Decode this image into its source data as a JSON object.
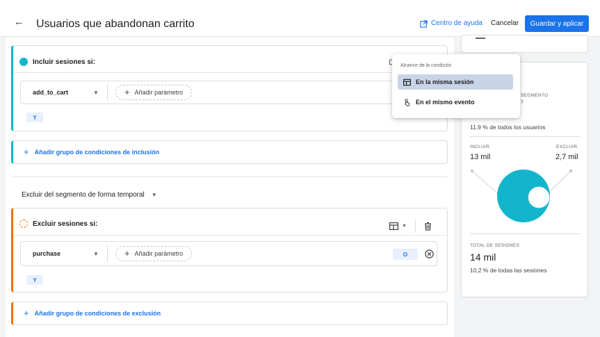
{
  "header": {
    "back_icon": "arrow-left-icon",
    "title": "Usuarios que abandonan carrito",
    "help_label": "Centro de ayuda",
    "help_icon": "external-link-icon",
    "cancel_label": "Cancelar",
    "save_label": "Guardar y aplicar",
    "accent_color": "#1a73e8"
  },
  "include_group": {
    "title": "Incluir sesiones si:",
    "color": "#12b5cb",
    "condition": {
      "event": "add_to_cart",
      "add_param_label": "Añadir parámetro"
    },
    "and_label": "Y"
  },
  "add_include_group_label": "Añadir grupo de condiciones de inclusión",
  "temporal_exclude_label": "Excluir del segmento de forma temporal",
  "exclude_group": {
    "title": "Excluir sesiones si:",
    "color": "#e8710a",
    "condition": {
      "event": "purchase",
      "add_param_label": "Añadir parámetro",
      "or_label": "O"
    },
    "and_label": "Y"
  },
  "add_exclude_group_label": "Añadir grupo de condiciones de exclusión",
  "scope_popup": {
    "label": "Alcance de la condición",
    "options": [
      {
        "label": "En la misma sesión",
        "icon": "table-icon",
        "selected": true
      },
      {
        "label": "En el mismo evento",
        "icon": "touch-icon",
        "selected": false
      }
    ]
  },
  "summary": {
    "partial_label_1": "SEGMENTO",
    "partial_label_2": "T",
    "users_pct": "11,9 % de todos los usuarios",
    "include_label": "INCLUIR",
    "exclude_label": "EXCLUIR",
    "include_value": "13 mil",
    "exclude_value": "2,7 mil",
    "donut_color": "#12b5cb",
    "sessions_label": "TOTAL DE SESIONES",
    "sessions_value": "14 mil",
    "sessions_pct": "10,2 % de todas las sesiones"
  }
}
